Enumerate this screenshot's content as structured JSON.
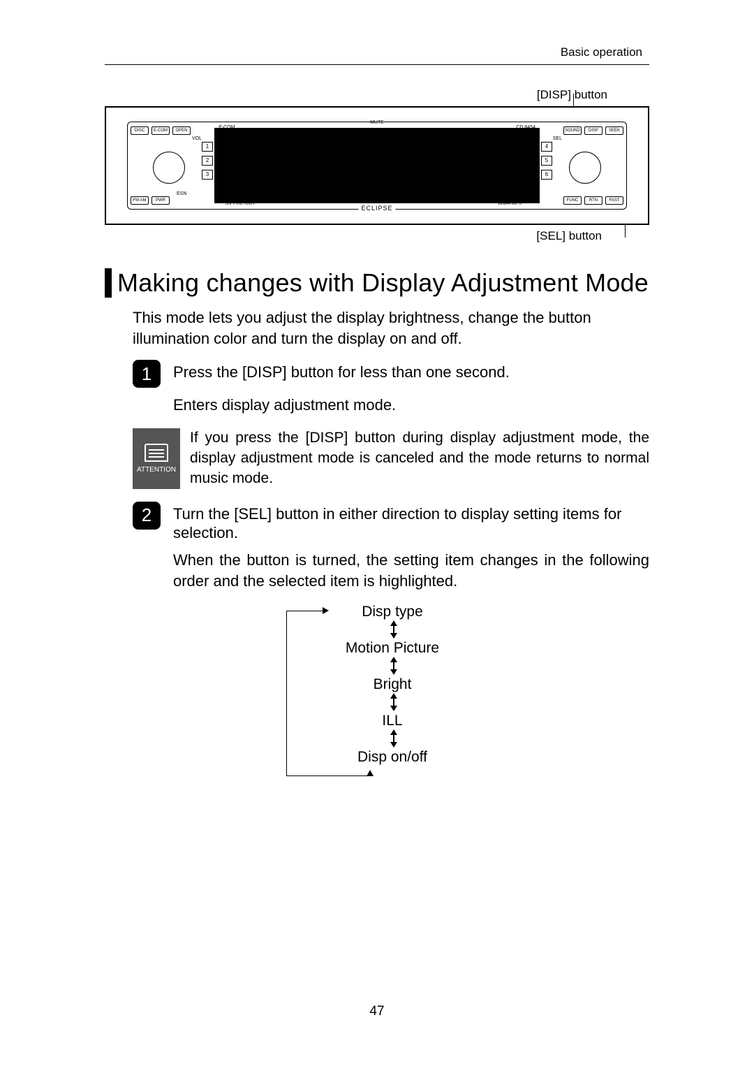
{
  "header": {
    "section": "Basic operation"
  },
  "callouts": {
    "disp": "[DISP] button",
    "sel": "[SEL] button"
  },
  "stereo": {
    "model": "CD 8454",
    "brand": "ECLIPSE",
    "ecom": "E-COM",
    "top_buttons_left": [
      "DISC",
      "E-COM",
      "OPEN"
    ],
    "top_buttons_right": [
      "SOUND",
      "DISP",
      "SEEK"
    ],
    "bottom_buttons_left": [
      "FM AM",
      "PWR"
    ],
    "bottom_buttons_right": [
      "FUNC",
      "RTN",
      "FAST"
    ],
    "labels": {
      "mute": "MUTE",
      "vol": "VOL",
      "esn": "ESN",
      "sel": "SEL",
      "sv": "SV PRE-OUT",
      "wma": "WMA·MP3"
    },
    "preset_rows": [
      "1",
      "2",
      "3",
      "4",
      "5",
      "6"
    ]
  },
  "section_title": "Making changes with Display Adjustment Mode",
  "intro": "This mode lets you adjust the display brightness, change the button illumination color and turn the display on and off.",
  "steps": [
    {
      "num": "1",
      "title": "Press the [DISP] button for less than one second.",
      "body": "Enters display adjustment mode."
    },
    {
      "num": "2",
      "title": "Turn the [SEL] button in either direction to display setting items for selection.",
      "body": "When the button is turned, the setting item changes in the following order and the selected item is highlighted."
    }
  ],
  "attention": {
    "label": "ATTENTION",
    "text": "If you press the [DISP] button during display adjustment mode, the display adjustment mode is canceled and the mode returns to normal music mode."
  },
  "cycle": [
    "Disp type",
    "Motion Picture",
    "Bright",
    "ILL",
    "Disp on/off"
  ],
  "page_number": "47"
}
